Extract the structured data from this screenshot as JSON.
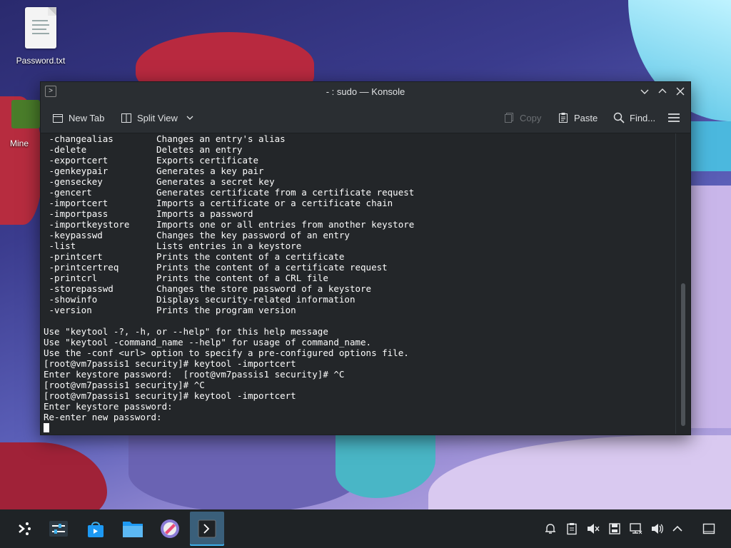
{
  "desktop": {
    "icons": [
      {
        "label": "Password.txt",
        "icon": "text-file-icon"
      },
      {
        "label": "Mine",
        "icon": "minecraft-icon"
      }
    ]
  },
  "window": {
    "title": "- : sudo — Konsole",
    "toolbar": {
      "new_tab": "New Tab",
      "split_view": "Split View",
      "copy": "Copy",
      "paste": "Paste",
      "find": "Find..."
    }
  },
  "terminal": {
    "lines": [
      " -changealias        Changes an entry's alias",
      " -delete             Deletes an entry",
      " -exportcert         Exports certificate",
      " -genkeypair         Generates a key pair",
      " -genseckey          Generates a secret key",
      " -gencert            Generates certificate from a certificate request",
      " -importcert         Imports a certificate or a certificate chain",
      " -importpass         Imports a password",
      " -importkeystore     Imports one or all entries from another keystore",
      " -keypasswd          Changes the key password of an entry",
      " -list               Lists entries in a keystore",
      " -printcert          Prints the content of a certificate",
      " -printcertreq       Prints the content of a certificate request",
      " -printcrl           Prints the content of a CRL file",
      " -storepasswd        Changes the store password of a keystore",
      " -showinfo           Displays security-related information",
      " -version            Prints the program version",
      "",
      "Use \"keytool -?, -h, or --help\" for this help message",
      "Use \"keytool -command_name --help\" for usage of command_name.",
      "Use the -conf <url> option to specify a pre-configured options file.",
      "[root@vm7passis1 security]# keytool -importcert",
      "Enter keystore password:  [root@vm7passis1 security]# ^C",
      "[root@vm7passis1 security]# ^C",
      "[root@vm7passis1 security]# keytool -importcert",
      "Enter keystore password:",
      "Re-enter new password:"
    ]
  },
  "taskbar": {
    "items": [
      "application-launcher-icon",
      "system-settings-icon",
      "discover-store-icon",
      "dolphin-files-icon",
      "krita-icon",
      "konsole-icon"
    ],
    "tray": [
      "notifications-icon",
      "clipboard-icon",
      "audio-muted-icon",
      "storage-icon",
      "network-icon",
      "volume-icon",
      "expand-tray-icon",
      "show-desktop-icon"
    ]
  },
  "colors": {
    "window_bg": "#232629",
    "titlebar": "#2a2e32",
    "terminal_fg": "#fcfcfc",
    "taskbar": "#1f2326",
    "active_task": "#3a5f7a"
  }
}
